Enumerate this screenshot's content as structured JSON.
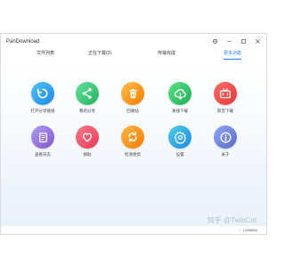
{
  "app": {
    "title": "PanDownload"
  },
  "window_controls": {
    "settings": "gear-icon",
    "minimize": "minimize-icon",
    "maximize": "maximize-icon",
    "close": "close-icon"
  },
  "tabs": [
    {
      "label": "文件列表",
      "active": false
    },
    {
      "label": "正在下载(2)",
      "active": false
    },
    {
      "label": "传输完成",
      "active": false
    },
    {
      "label": "更多功能",
      "active": true
    }
  ],
  "tiles": [
    {
      "label": "打开分享链接",
      "icon": "link-icon",
      "color_from": "#4fc3f7",
      "color_to": "#1e88e5"
    },
    {
      "label": "我的分享",
      "icon": "share-icon",
      "color_from": "#66e09a",
      "color_to": "#22b35e"
    },
    {
      "label": "回收站",
      "icon": "trash-icon",
      "color_from": "#ffc04d",
      "color_to": "#f57c00"
    },
    {
      "label": "离线下载",
      "icon": "cloud-download-icon",
      "color_from": "#5de08a",
      "color_to": "#1fae55"
    },
    {
      "label": "影音下载",
      "icon": "tv-icon",
      "color_from": "#ff6b6b",
      "color_to": "#e53935"
    },
    {
      "label": "查看日志",
      "icon": "document-icon",
      "color_from": "#b39dfb",
      "color_to": "#7e57c2"
    },
    {
      "label": "捐助",
      "icon": "heart-icon",
      "color_from": "#ff7a8a",
      "color_to": "#e53955"
    },
    {
      "label": "检测更新",
      "icon": "refresh-icon",
      "color_from": "#ffb74d",
      "color_to": "#f57c00"
    },
    {
      "label": "设置",
      "icon": "gear-icon",
      "color_from": "#4dd0e1",
      "color_to": "#1e88e5"
    },
    {
      "label": "关于",
      "icon": "info-icon",
      "color_from": "#90a4ff",
      "color_to": "#5c6bc0"
    }
  ],
  "status": {
    "speed": "1.59MB/s"
  },
  "watermark": "知乎 @TwinCat"
}
